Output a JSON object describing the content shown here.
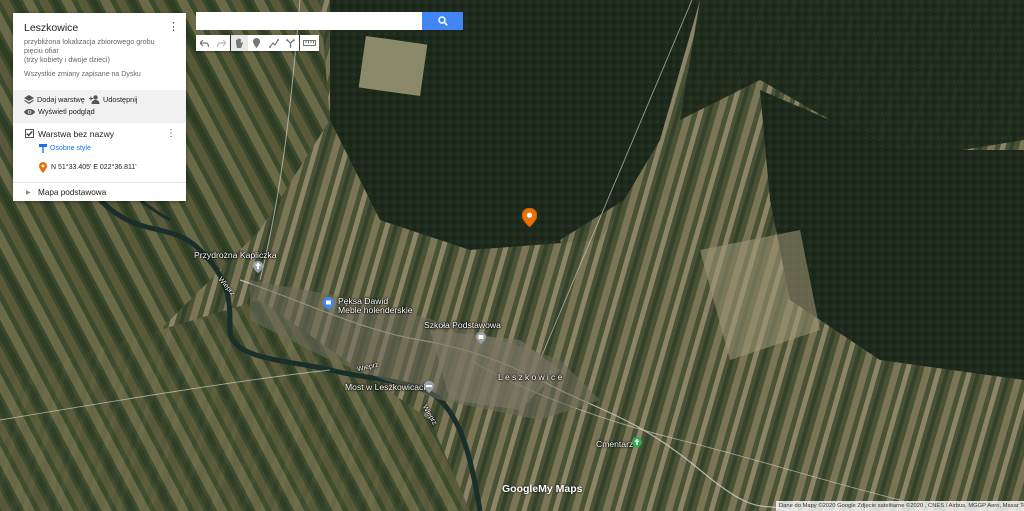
{
  "map": {
    "type": "satellite",
    "place_labels": {
      "chapel": "Przydrożna Kapliczka",
      "shop_line1": "Pęksa Dawid",
      "shop_line2": "Meble holenderskie",
      "school": "Szkoła Podstawowa",
      "village": "Leszkowice",
      "bridge": "Most w Leszkowicach",
      "cemetery": "Cmentarz",
      "river_a": "Wieprz",
      "river_b": "Wieprz",
      "river_c": "Wieprz"
    },
    "marker": {
      "icon": "map-pin-icon",
      "color": "#e8710a"
    },
    "logo_google": "Google",
    "logo_mymaps": "My Maps",
    "attribution": "Dane do Mapy ©2020 Google Zdjęcie satelitarne ©2020 , CNES / Airbus, MGGP Aero, Maxar Te"
  },
  "panel": {
    "title": "Leszkowice",
    "description_line1": "przybliżona lokalizacja zbiorowego grobu",
    "description_line2": "pięciu ofiar",
    "description_line3": "(trzy kobiety i dwoje dzieci)",
    "saved_status": "Wszystkie zmiany zapisane na Dysku",
    "actions": {
      "add_layer": "Dodaj warstwę",
      "share": "Udostępnij",
      "preview": "Wyświetl podgląd"
    },
    "layer": {
      "name": "Warstwa bez nazwy",
      "style_label": "Osobne style",
      "point_label": "N 51°33.405' E 022°36.811'"
    },
    "base_map_label": "Mapa podstawowa"
  },
  "toolbar": {
    "search_value": "",
    "search_placeholder": "",
    "tools": [
      "undo-icon",
      "redo-icon",
      "hand-icon",
      "marker-tool-icon",
      "line-tool-icon",
      "route-icon",
      "ruler-icon"
    ]
  },
  "colors": {
    "accent": "#4285f4",
    "link": "#1a73e8",
    "marker": "#e8710a",
    "poi_blue": "#4285f4",
    "poi_green": "#34a853"
  }
}
